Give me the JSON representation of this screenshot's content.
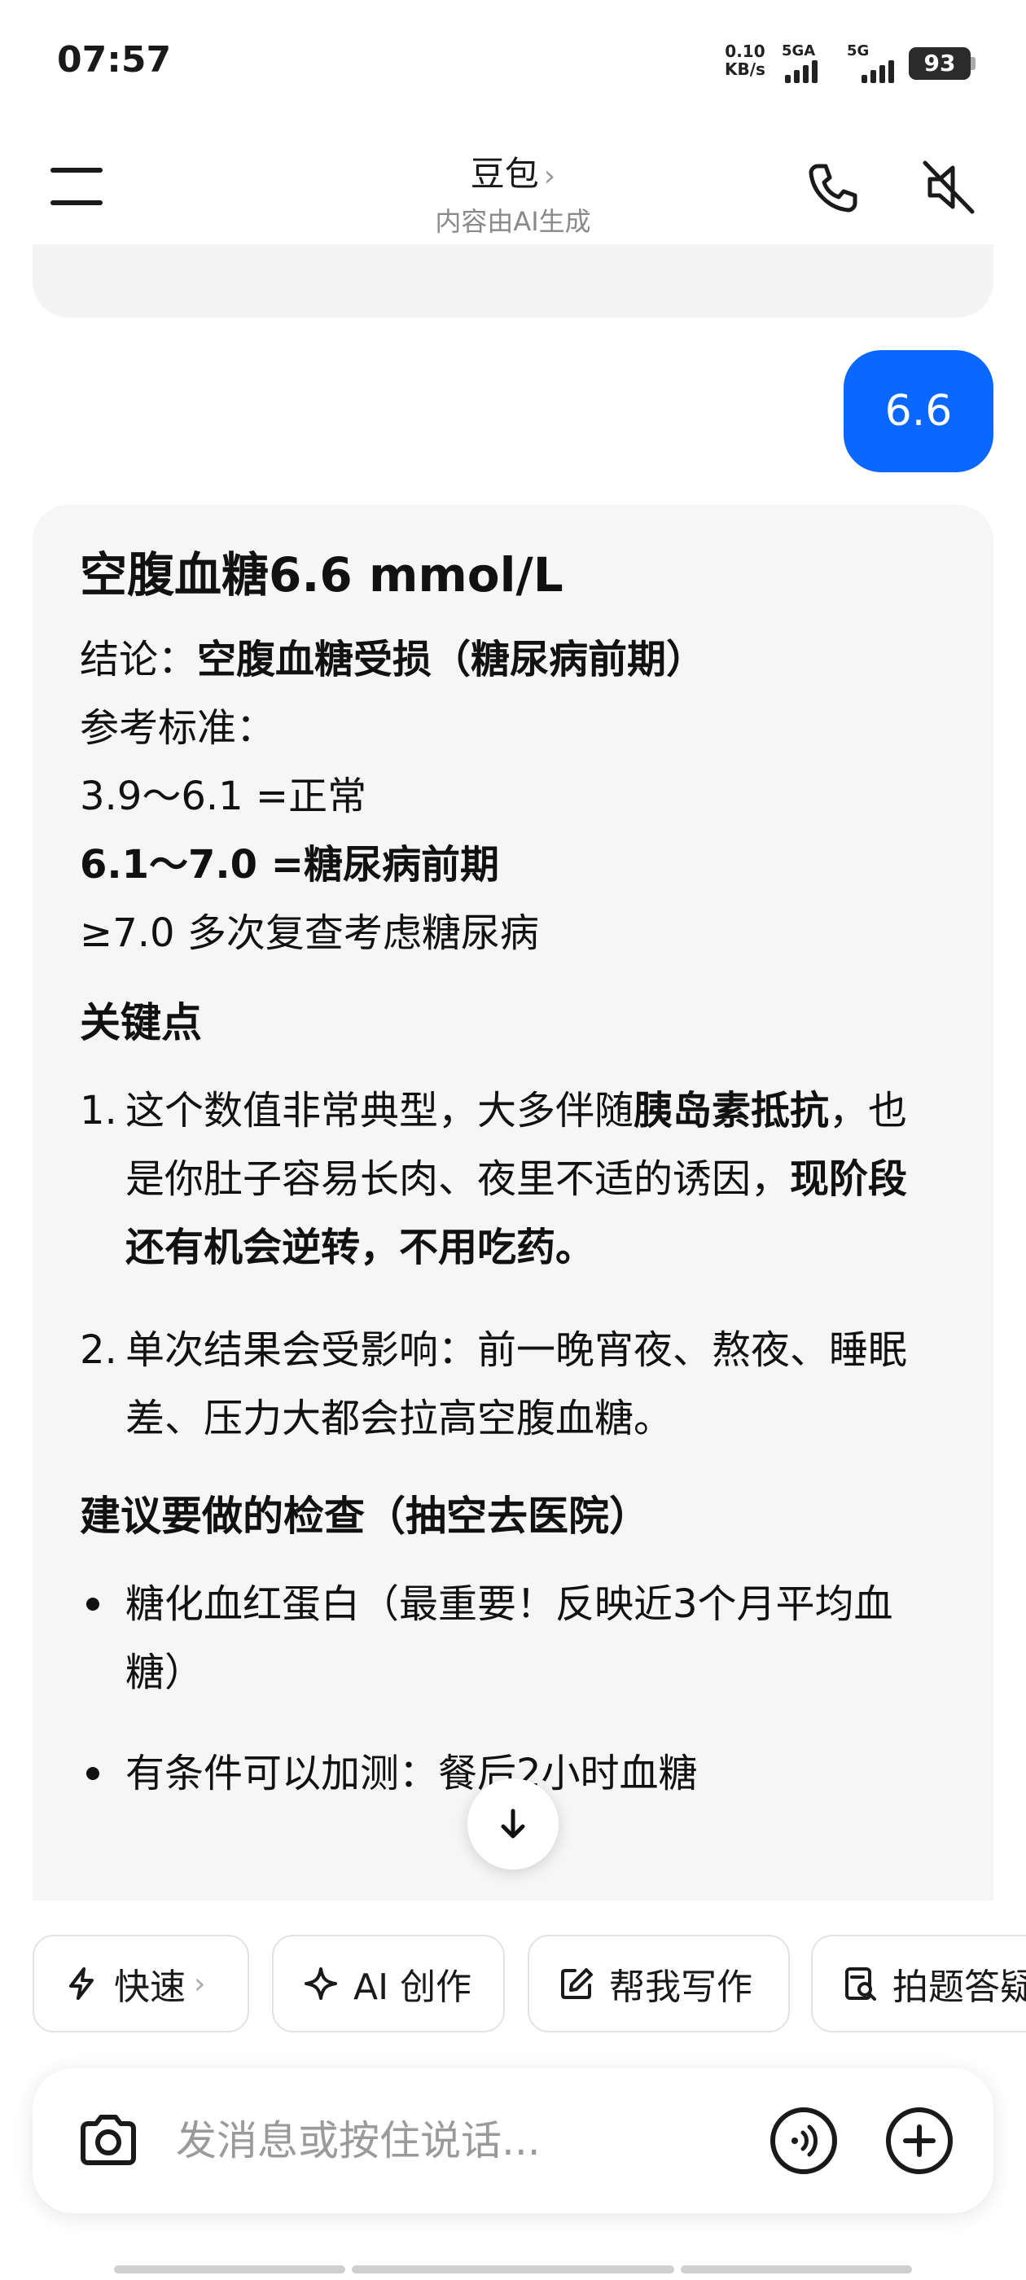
{
  "status_bar": {
    "time": "07:57",
    "net_speed_value": "0.10",
    "net_speed_unit": "KB/s",
    "signal_1": "5GA",
    "signal_2": "5G",
    "battery": "93"
  },
  "header": {
    "title": "豆包",
    "title_chevron": "›",
    "subtitle": "内容由AI生成",
    "icons": [
      "menu-icon",
      "phone-icon",
      "speaker-muted-icon"
    ]
  },
  "chat": {
    "user_message": "6.6",
    "ai_reply": {
      "heading": "空腹血糖6.6 mmol/L",
      "conclusion_label": "结论：",
      "conclusion_value": "空腹血糖受损（糖尿病前期）",
      "reference_label": "参考标准：",
      "ref_normal": "3.9～6.1 =正常",
      "ref_prediabetes": "6.1～7.0 =糖尿病前期",
      "ref_diabetes": "≥7.0 多次复查考虑糖尿病",
      "key_points_title": "关键点",
      "point1_num": "1.",
      "point1_a": "这个数值非常典型，大多伴随",
      "point1_b": "胰岛素抵抗",
      "point1_c": "，也是你肚子容易长肉、夜里不适的诱因，",
      "point1_d": "现阶段还有机会逆转，不用吃药。",
      "point2_num": "2.",
      "point2": "单次结果会受影响：前一晚宵夜、熬夜、睡眠差、压力大都会拉高空腹血糖。",
      "checks_title": "建议要做的检查（抽空去医院）",
      "check1": "糖化血红蛋白（最重要！反映近3个月平均血糖）",
      "check2": "有条件可以加测：餐后2小时血糖"
    }
  },
  "chips": [
    {
      "label": "快速",
      "icon": "lightning-icon",
      "chevron": "›"
    },
    {
      "label": "AI 创作",
      "icon": "sparkle-icon"
    },
    {
      "label": "帮我写作",
      "icon": "edit-icon"
    },
    {
      "label": "拍题答疑",
      "icon": "scan-question-icon"
    }
  ],
  "input": {
    "placeholder": "发消息或按住说话..."
  },
  "colors": {
    "accent": "#0a67ff",
    "bubble_bg": "#f6f6f6"
  }
}
